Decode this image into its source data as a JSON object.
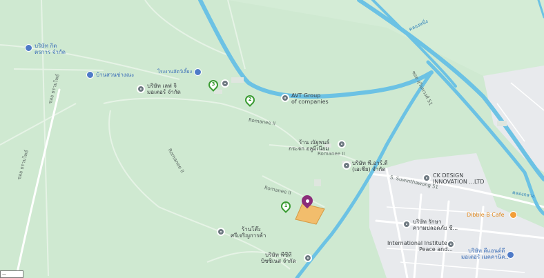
{
  "map": {
    "colors": {
      "land": "#cfe9d1",
      "water": "#6cc2e4",
      "urban": "#e8eaed",
      "road_major": "#ffffff",
      "parcel": "#f2bd6c",
      "marker_green": "#3a9b32",
      "marker_purple": "#8b2d7a"
    },
    "pois": [
      {
        "name": "AVT Group of companies",
        "line1": "AVT Group",
        "line2": "of companies",
        "icon": "place-icon"
      },
      {
        "name": "CK DESIGN INNOVATION LTD",
        "line1": "CK DESIGN",
        "line2": "INNOVATION ...LTD",
        "icon": "place-icon"
      },
      {
        "name": "Dibble B Cafe",
        "line1": "Dibble B Cafe",
        "icon": "cafe-icon"
      },
      {
        "name": "International Institute of Peace and...",
        "line1": "International Institute of",
        "line2": "Peace and...",
        "icon": "place-icon"
      },
      {
        "name": "บริษัท กิต ตรการ จำกัด",
        "line1": "บริษัท กิต",
        "line2": "ตรการ จำกัด",
        "icon": "building-icon"
      },
      {
        "name": "บ้านสวนช่างณะ",
        "line1": "บ้านสวนช่างณะ",
        "icon": "building-icon"
      },
      {
        "name": "โรงงานสัตว์เลี้ยง",
        "line1": "โรงงานสัตว์เลี้ยง",
        "icon": "building-icon"
      },
      {
        "name": "บริษัท เลฟ จิ มอเตอร์ จำกัด",
        "line1": "บริษัท เลฟ จิ",
        "line2": "มอเตอร์ จำกัด",
        "icon": "place-icon"
      },
      {
        "name": "ร้าน ณัฐพนธ์ กระจก อลูมิเนียม",
        "line1": "ร้าน ณัฐพนธ์",
        "line2": "กระจก อลูมิเนียม",
        "icon": "place-icon"
      },
      {
        "name": "บริษัท พี.อาร์.ดี (เอเชีย) จำกัด",
        "line1": "บริษัท พี.อาร์.ดี",
        "line2": "(เอเชีย) จำกัด",
        "icon": "place-icon"
      },
      {
        "name": "บริษัท รักษา ความปลอดภัย ซี...",
        "line1": "บริษัท รักษา",
        "line2": "ความปลอดภัย ซี...",
        "icon": "place-icon"
      },
      {
        "name": "ร้านโต๊ะ ศรีเจริญการค้า",
        "line1": "ร้านโต๊ะ",
        "line2": "ศรีเจริญการค้า",
        "icon": "place-icon"
      },
      {
        "name": "บริษัท พีซีที บิซซิเนส จำกัด",
        "line1": "บริษัท พีซีที",
        "line2": "บิซซิเนส จำกัด",
        "icon": "place-icon"
      },
      {
        "name": "บริษัท ดีแอนด์ดี มอเตอร์ เมคคานิค...",
        "line1": "บริษัท ดีแอนด์ดี",
        "line2": "มอเตอร์ เมคคานิค...",
        "icon": "building-icon"
      }
    ],
    "roads": [
      "Romanee II",
      "Romanee II",
      "Romanee II",
      "Romanee II",
      "S. Suwinthawong 51",
      "ซอย ธรามไพธ์",
      "ซอย ธรามไพธ์",
      "ซอย สุวินทวงศ์ 51"
    ],
    "waterways": [
      "คลองหนึ่ง",
      "คลองกลาง"
    ],
    "markers": [
      {
        "label": "1",
        "color": "#3a9b32"
      },
      {
        "label": "2",
        "color": "#3a9b32"
      },
      {
        "label": "3",
        "color": "#3a9b32"
      }
    ],
    "scale_label": "—"
  }
}
